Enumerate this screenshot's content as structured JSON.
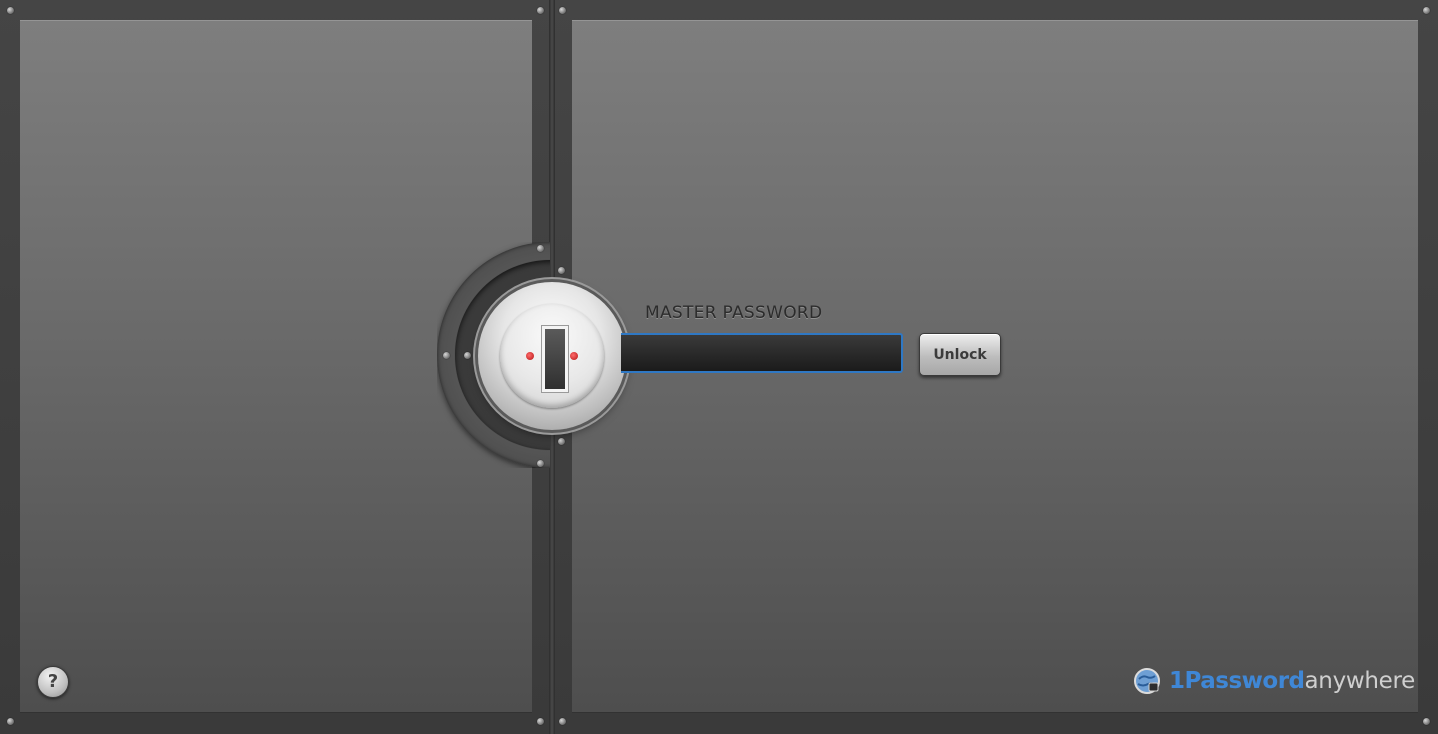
{
  "login": {
    "label": "MASTER PASSWORD",
    "password_value": "",
    "password_placeholder": "",
    "unlock_label": "Unlock"
  },
  "help": {
    "label": "?"
  },
  "logo": {
    "brand": "1Password",
    "suffix": "anywhere"
  },
  "colors": {
    "accent_blue": "#2f78c4",
    "logo_blue": "#3f87d6",
    "lock_indicator_red": "#b41414"
  },
  "icons": [
    "lock-dial-icon",
    "keyhole-icon",
    "help-icon",
    "globe-logo-icon"
  ]
}
